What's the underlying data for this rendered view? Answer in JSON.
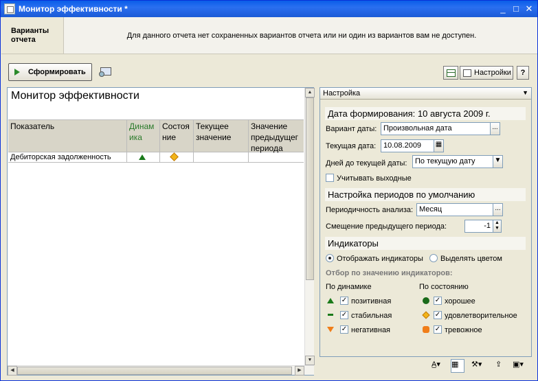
{
  "window": {
    "title": "Монитор эффективности *",
    "controls": {
      "minimize": "_",
      "maximize": "□",
      "close": "✕"
    }
  },
  "variants": {
    "label": "Варианты отчета",
    "message": "Для данного отчета нет сохраненных вариантов отчета или ни один из вариантов вам не доступен."
  },
  "toolbar": {
    "generate_label": "Сформировать",
    "settings_label": "Настройки",
    "help_label": "?"
  },
  "report": {
    "title": "Монитор эффективности",
    "columns": [
      "Показатель",
      "Динамика",
      "Состояние",
      "Текущее значение",
      "Значение предыдущего периода"
    ],
    "column_display": [
      "Показатель",
      "Динам ика",
      "Состоя ние",
      "Текущее значение",
      "Значение предыдущег периода"
    ],
    "rows": [
      {
        "indicator": "Дебиторская задолженность",
        "dynamics_icon": "triangle-up-green-icon",
        "state_icon": "diamond-yellow-icon",
        "current": "",
        "previous": ""
      }
    ]
  },
  "settings": {
    "header": "Настройка",
    "date_section": "Дата формирования: 10 августа 2009 г.",
    "date_variant_label": "Вариант даты:",
    "date_variant_value": "Произвольная дата",
    "current_date_label": "Текущая дата:",
    "current_date_value": "10.08.2009",
    "days_label": "Дней до текущей даты:",
    "days_value": "По текущую дату",
    "weekends_label": "Учитывать выходные",
    "weekends_checked": false,
    "period_section": "Настройка периодов по умолчанию",
    "periodicity_label": "Периодичность анализа:",
    "periodicity_value": "Месяц",
    "offset_label": "Смещение предыдущего периода:",
    "offset_value": "-1",
    "indicators_section": "Индикаторы",
    "radio_show": "Отображать индикаторы",
    "radio_color": "Выделять цветом",
    "radio_selected": "show",
    "filter_head": "Отбор по значению индикаторов:",
    "by_dynamics": "По динамике",
    "by_state": "По состоянию",
    "dynamics": [
      {
        "label": "позитивная",
        "checked": true,
        "icon": "triangle-up-green-icon"
      },
      {
        "label": "стабильная",
        "checked": true,
        "icon": "dash-green-icon"
      },
      {
        "label": "негативная",
        "checked": true,
        "icon": "triangle-down-orange-icon"
      }
    ],
    "states": [
      {
        "label": "хорошее",
        "checked": true,
        "icon": "circle-green-icon"
      },
      {
        "label": "удовлетворительное",
        "checked": true,
        "icon": "diamond-yellow-icon"
      },
      {
        "label": "тревожное",
        "checked": true,
        "icon": "octagon-orange-icon"
      }
    ]
  },
  "icons": {
    "check": "✓",
    "ellipsis": "...",
    "dropdown": "▼",
    "up": "▲",
    "down": "▼",
    "left": "◀",
    "right": "▶"
  }
}
